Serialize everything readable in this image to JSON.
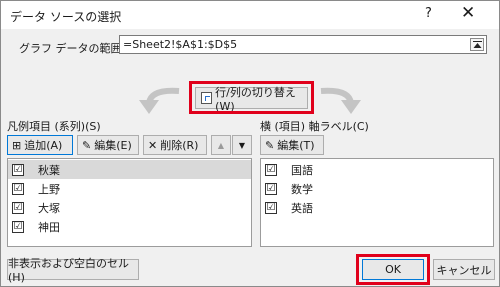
{
  "window": {
    "title": "データ ソースの選択",
    "help_label": "?",
    "close_label": "✕"
  },
  "range": {
    "label": "グラフ データの範囲(D):",
    "value": "=Sheet2!$A$1:$D$5",
    "collapse_icon": "collapse-icon"
  },
  "switch_button": {
    "label": "行/列の切り替え(W)"
  },
  "legend_panel": {
    "label": "凡例項目 (系列)(S)",
    "add_label": "追加(A)",
    "edit_label": "編集(E)",
    "delete_label": "削除(R)",
    "up_label": "▲",
    "down_label": "▼",
    "items": [
      {
        "label": "秋葉",
        "checked": "☑",
        "selected": true
      },
      {
        "label": "上野",
        "checked": "☑",
        "selected": false
      },
      {
        "label": "大塚",
        "checked": "☑",
        "selected": false
      },
      {
        "label": "神田",
        "checked": "☑",
        "selected": false
      }
    ]
  },
  "axis_panel": {
    "label": "横 (項目) 軸ラベル(C)",
    "edit_label": "編集(T)",
    "items": [
      {
        "label": "国語",
        "checked": "☑"
      },
      {
        "label": "数学",
        "checked": "☑"
      },
      {
        "label": "英語",
        "checked": "☑"
      }
    ]
  },
  "footer": {
    "hidden_cells_label": "非表示および空白のセル(H)",
    "ok_label": "OK",
    "cancel_label": "キャンセル"
  },
  "colors": {
    "highlight": "#e0001b",
    "ok_border": "#0078d7"
  }
}
